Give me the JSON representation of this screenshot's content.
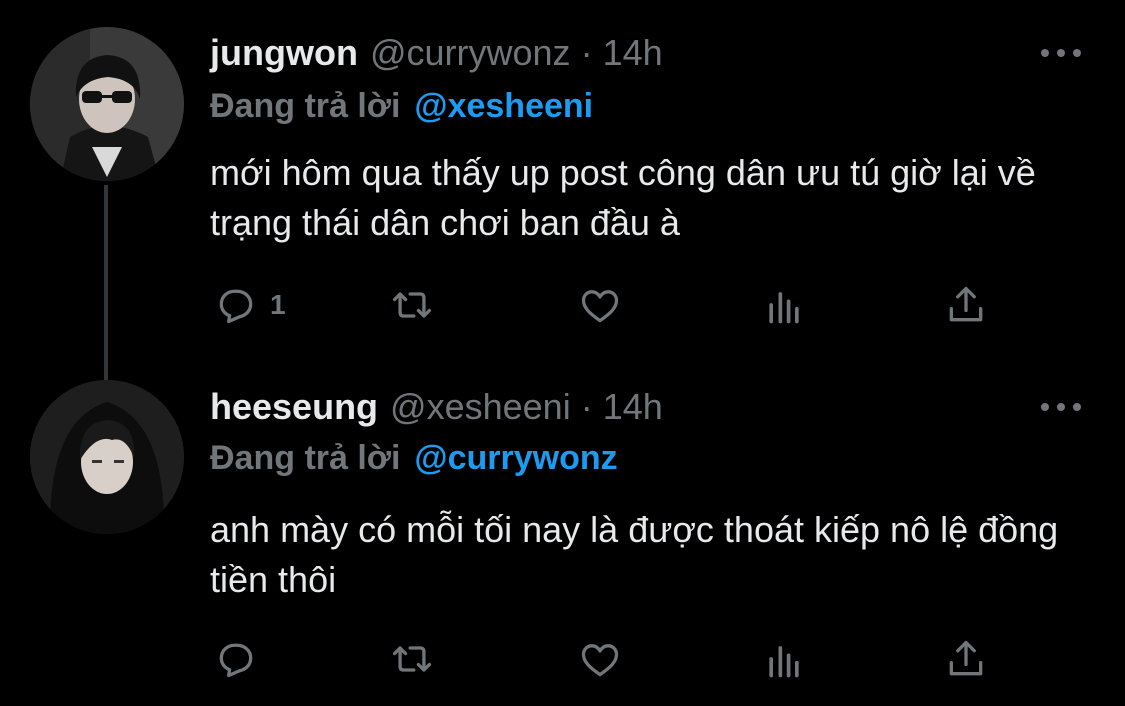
{
  "tweets": [
    {
      "name": "jungwon",
      "handle": "@currywonz",
      "dot": "·",
      "time": "14h",
      "reply_label": "Đang trả lời",
      "reply_to": "@xesheeni",
      "text": "mới hôm qua thấy up post công dân ưu tú giờ lại về trạng thái dân chơi ban đầu à",
      "reply_count": "1"
    },
    {
      "name": "heeseung",
      "handle": "@xesheeni",
      "dot": "·",
      "time": "14h",
      "reply_label": "Đang trả lời",
      "reply_to": "@currywonz",
      "text": "anh mày có mỗi tối nay là được thoát kiếp nô lệ đồng tiền thôi",
      "reply_count": ""
    }
  ],
  "icons": {
    "reply": "reply-icon",
    "retweet": "retweet-icon",
    "like": "heart-icon",
    "views": "views-icon",
    "share": "share-icon",
    "more": "more-icon"
  },
  "colors": {
    "background": "#000000",
    "text": "#e7e9ea",
    "muted": "#71767b",
    "accent": "#1d9bf0",
    "thread_line": "#333639"
  }
}
